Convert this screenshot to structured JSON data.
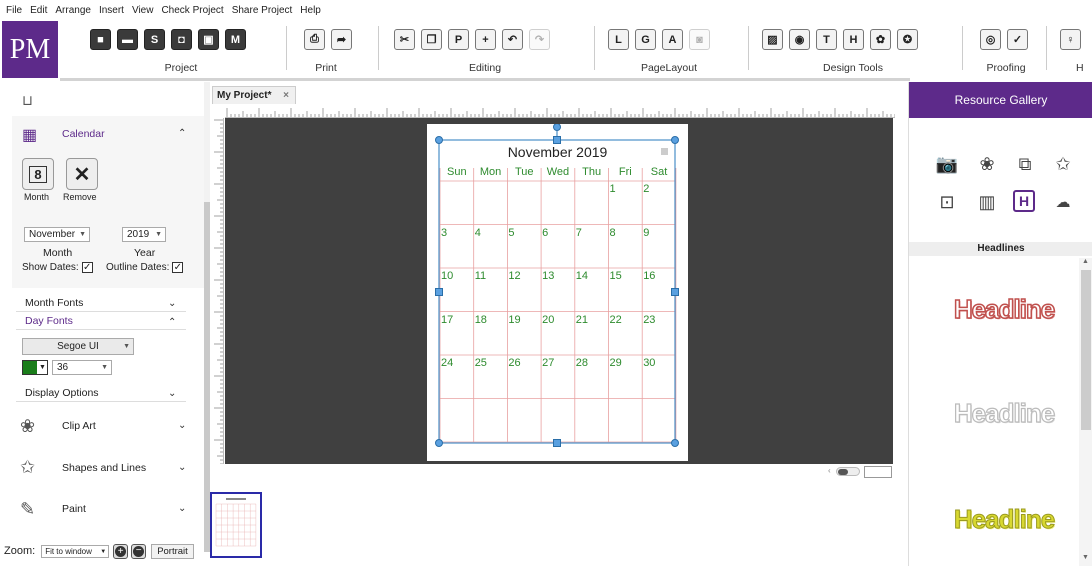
{
  "menu": [
    "File",
    "Edit",
    "Arrange",
    "Insert",
    "View",
    "Check Project",
    "Share Project",
    "Help"
  ],
  "logo": "PM",
  "ribbon": {
    "groups": [
      "Project",
      "Print",
      "Editing",
      "PageLayout",
      "Design Tools",
      "Proofing",
      "H"
    ]
  },
  "left_panel": {
    "calendar_label": "Calendar",
    "month_btn_label": "Month",
    "month_btn_glyph": "8",
    "remove_btn_label": "Remove",
    "month_select": "November",
    "year_select": "2019",
    "month_caption": "Month",
    "year_caption": "Year",
    "show_dates_label": "Show Dates:",
    "outline_dates_label": "Outline Dates:",
    "month_fonts": "Month Fonts",
    "day_fonts": "Day Fonts",
    "font_name": "Segoe UI",
    "font_size": "36",
    "display_options": "Display Options",
    "clip_art": "Clip Art",
    "shapes_lines": "Shapes and Lines",
    "paint": "Paint",
    "day_font_color": "#1a7d1a"
  },
  "tab": {
    "title": "My Project*",
    "close": "×"
  },
  "calendar": {
    "title": "November 2019",
    "weekdays": [
      "Sun",
      "Mon",
      "Tue",
      "Wed",
      "Thu",
      "Fri",
      "Sat"
    ],
    "weeks": [
      [
        "",
        "",
        "",
        "",
        "",
        "1",
        "2"
      ],
      [
        "3",
        "4",
        "5",
        "6",
        "7",
        "8",
        "9"
      ],
      [
        "10",
        "11",
        "12",
        "13",
        "14",
        "15",
        "16"
      ],
      [
        "17",
        "18",
        "19",
        "20",
        "21",
        "22",
        "23"
      ],
      [
        "24",
        "25",
        "26",
        "27",
        "28",
        "29",
        "30"
      ],
      [
        "",
        "",
        "",
        "",
        "",
        "",
        ""
      ]
    ],
    "grid_color": "#e8a0a0",
    "text_color": "#2e8b2e"
  },
  "right_panel": {
    "title": "Resource Gallery",
    "section": "Headlines",
    "headlines": [
      "Headline",
      "Headline",
      "Headline"
    ],
    "accent": "#5d2a8a"
  },
  "zoom": {
    "label": "Zoom:",
    "value": "Fit to window",
    "orientation": "Portrait"
  }
}
